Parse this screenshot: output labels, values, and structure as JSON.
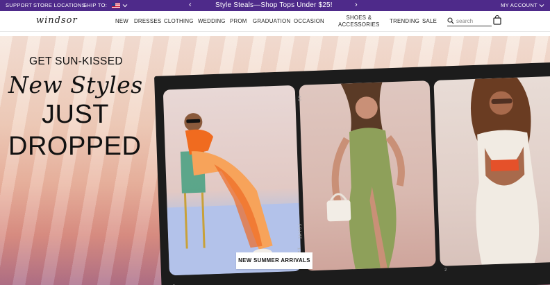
{
  "promo_bar": {
    "support": "SUPPORT",
    "store_locations": "STORE LOCATIONS",
    "ship_to": "SHIP TO:",
    "message": "Style Steals—Shop Tops Under $25!",
    "arrow_left": "‹",
    "arrow_right": "›",
    "account": "MY ACCOUNT",
    "background": "#4e2a8a"
  },
  "header": {
    "logo": "windsor",
    "nav": [
      {
        "label": "NEW"
      },
      {
        "label": "DRESSES"
      },
      {
        "label": "CLOTHING"
      },
      {
        "label": "WEDDING"
      },
      {
        "label": "PROM"
      },
      {
        "label": "GRADUATION"
      },
      {
        "label": "OCCASION"
      },
      {
        "label": "SHOES &",
        "label2": "ACCESSORIES"
      },
      {
        "label": "TRENDING"
      },
      {
        "label": "SALE"
      }
    ],
    "search_placeholder": "search"
  },
  "hero": {
    "eyebrow": "GET SUN-KISSED",
    "script": "New Styles",
    "headline_line1": "JUST",
    "headline_line2": "DROPPED",
    "cta": "NEW SUMMER ARRIVALS",
    "film_labels": {
      "frame_a": "43",
      "frame_b": "FRAME",
      "frame_c": "120PX",
      "frame_d": "3",
      "frame_e": "2"
    }
  },
  "icons": {
    "search": "search-icon",
    "bag": "shopping-bag-icon",
    "chevron": "chevron-down-icon",
    "flag": "us-flag-icon"
  }
}
